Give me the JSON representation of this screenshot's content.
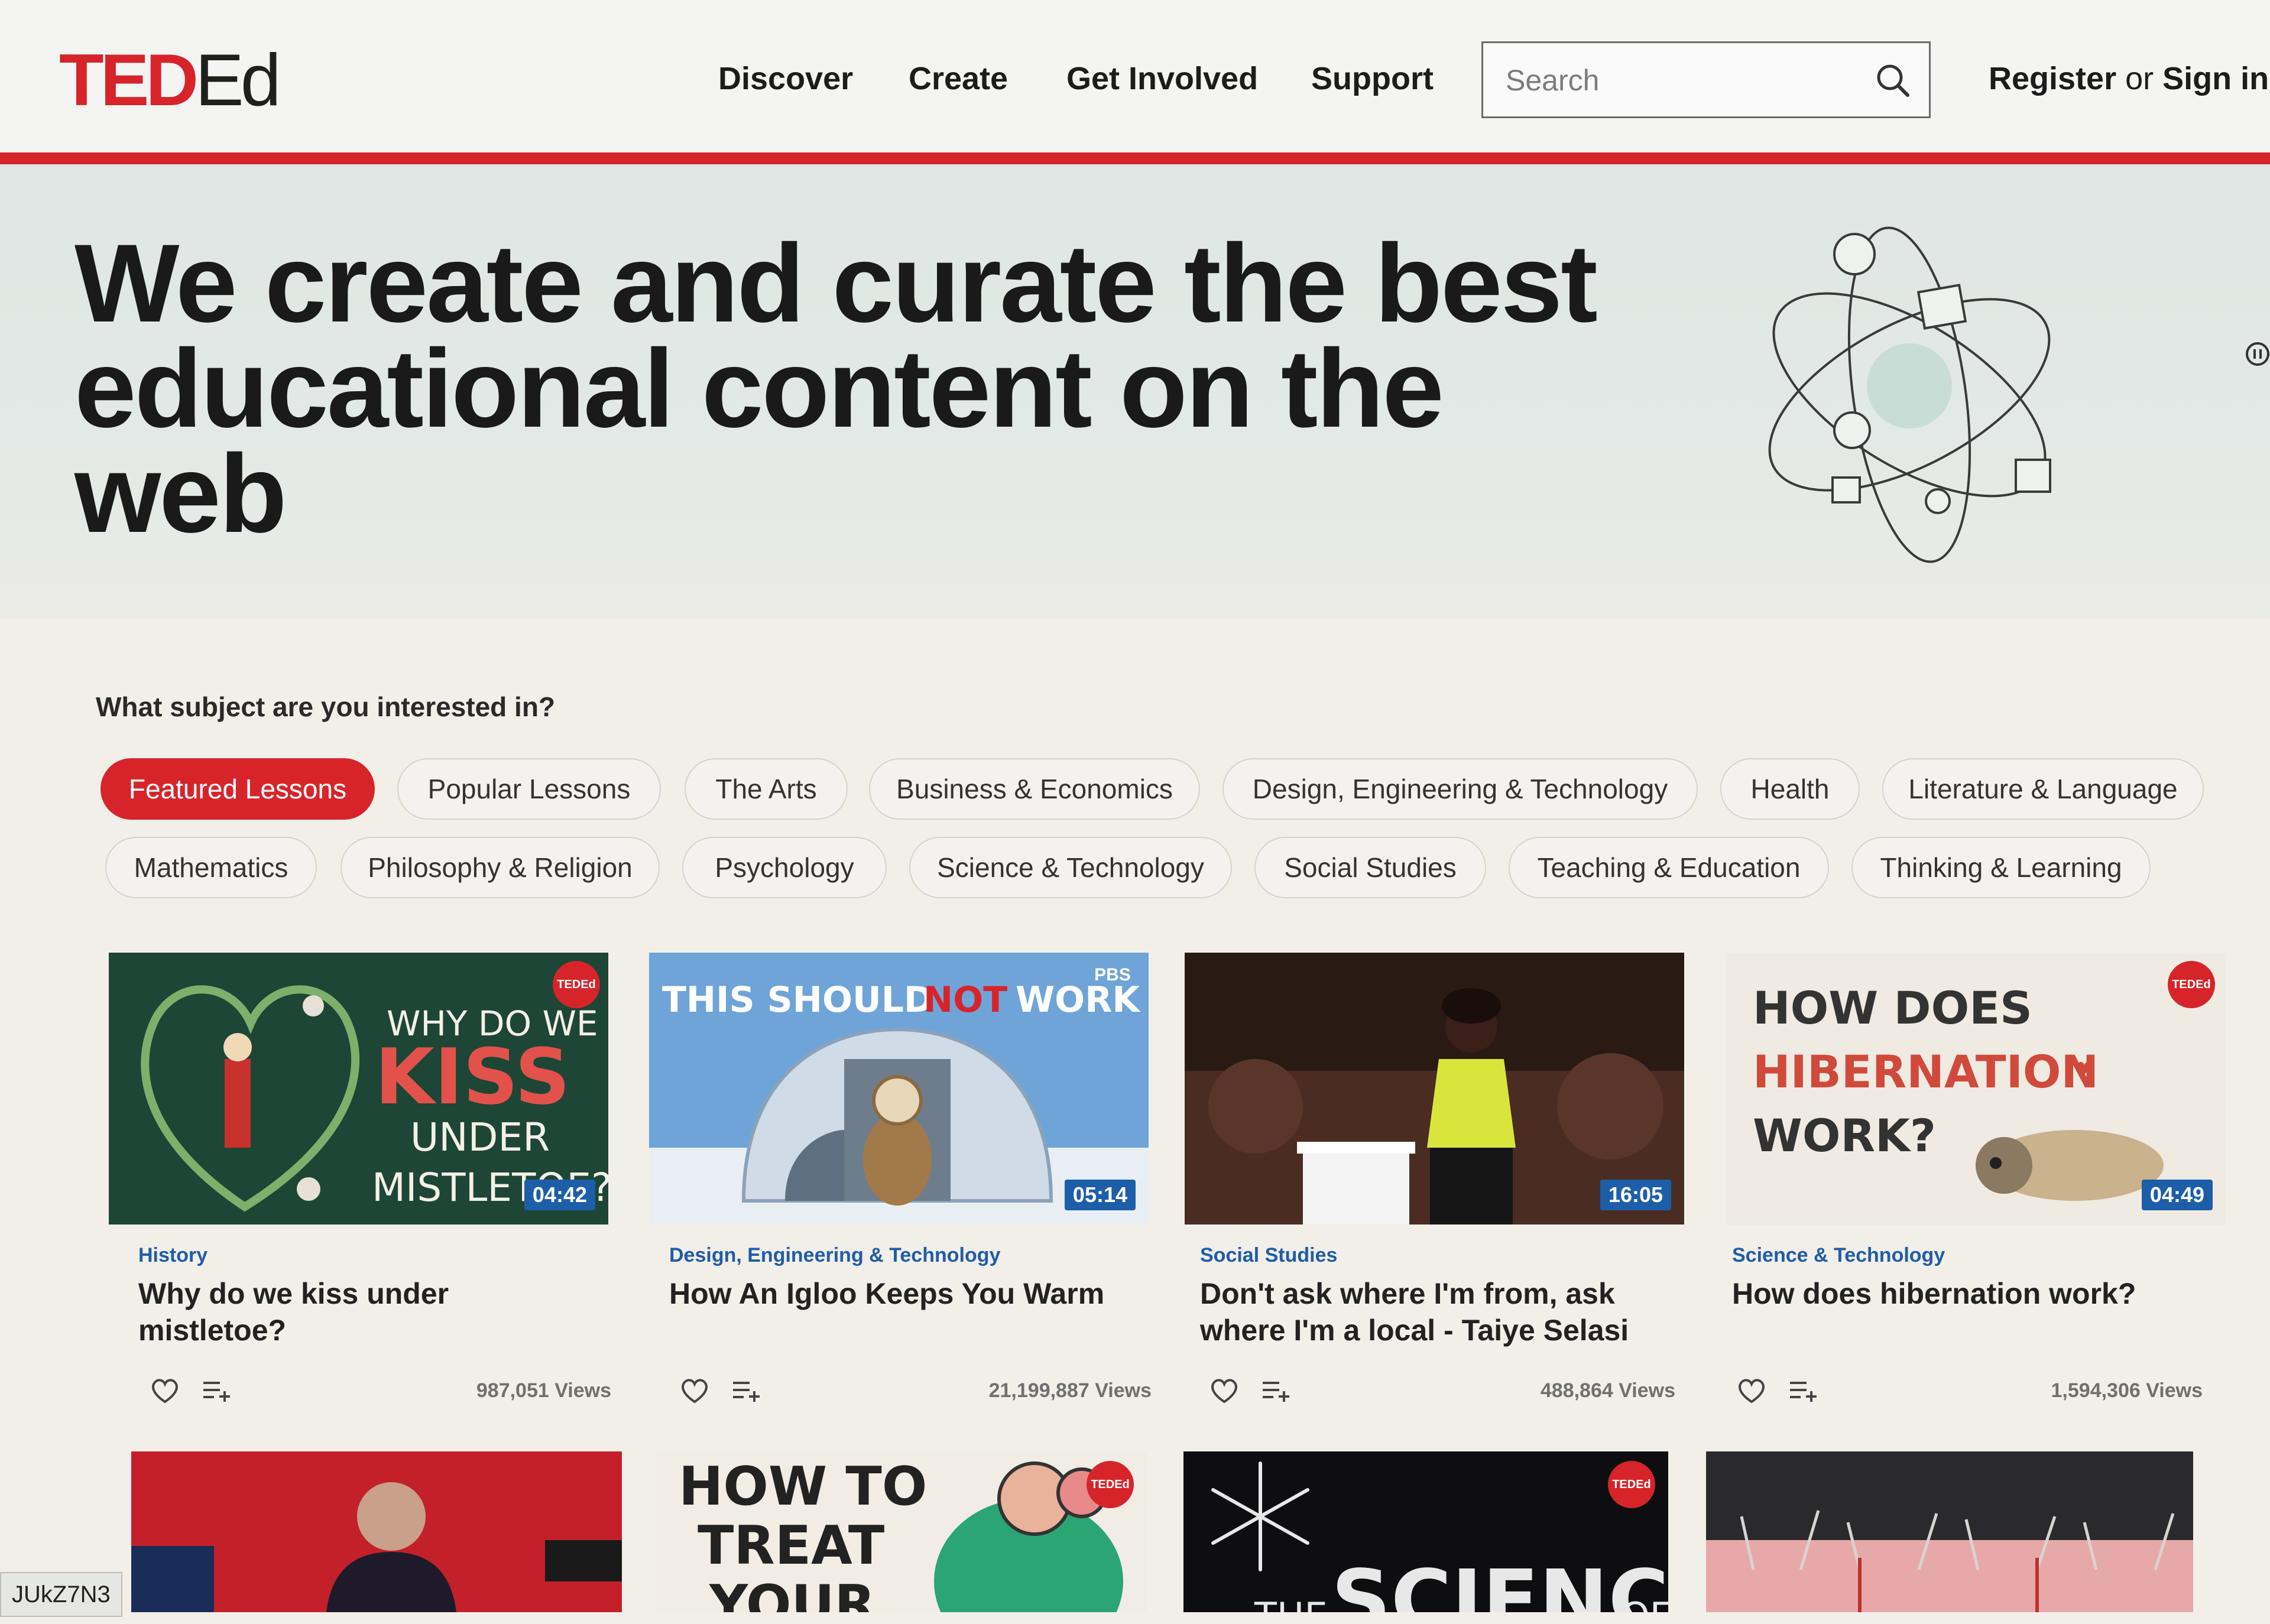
{
  "header": {
    "logo_ted": "TED",
    "logo_ed": "Ed",
    "nav": [
      "Discover",
      "Create",
      "Get Involved",
      "Support"
    ],
    "search_placeholder": "Search",
    "auth_register": "Register",
    "auth_or": "or",
    "auth_signin": "Sign in"
  },
  "hero": {
    "title": "We create and curate the best educational content on the web"
  },
  "subjects": {
    "question": "What subject are you interested in?",
    "active": "Featured Lessons",
    "row1": [
      "Featured Lessons",
      "Popular Lessons",
      "The Arts",
      "Business & Economics",
      "Design, Engineering & Technology",
      "Health",
      "Literature & Language"
    ],
    "row2": [
      "Mathematics",
      "Philosophy & Religion",
      "Psychology",
      "Science & Technology",
      "Social Studies",
      "Teaching & Education",
      "Thinking & Learning"
    ]
  },
  "lessons": [
    {
      "category": "History",
      "title": "Why do we kiss under mistletoe?",
      "duration": "04:42",
      "views": "987,051 Views",
      "thumb_text": [
        "WHY DO WE",
        "KISS",
        "UNDER",
        "MISTLETOE?"
      ],
      "badge": "TEDEd"
    },
    {
      "category": "Design, Engineering & Technology",
      "title": "How An Igloo Keeps You Warm",
      "duration": "05:14",
      "views": "21,199,887 Views",
      "thumb_text": [
        "THIS SHOULD",
        "NOT",
        "WORK"
      ],
      "badge": "PBS"
    },
    {
      "category": "Social Studies",
      "title": "Don't ask where I'm from, ask where I'm a local - Taiye Selasi",
      "duration": "16:05",
      "views": "488,864 Views"
    },
    {
      "category": "Science & Technology",
      "title": "How does hibernation work?",
      "duration": "04:49",
      "views": "1,594,306 Views",
      "thumb_text": [
        "HOW DOES",
        "HIBERNATION",
        "WORK?"
      ],
      "badge": "TEDEd"
    }
  ],
  "bottom_row": [
    {
      "thumb_text": []
    },
    {
      "thumb_text": [
        "HOW TO",
        "TREAT",
        "YOUR"
      ],
      "badge": "TEDEd"
    },
    {
      "thumb_text": [
        "THE",
        "SCIENCE",
        "OF"
      ],
      "badge": "TEDEd"
    },
    {
      "thumb_text": []
    }
  ],
  "url_fragment": "JUkZ7N3",
  "colors": {
    "brand_red": "#d7242b",
    "category_blue": "#1f5da8",
    "duration_blue": "#1d5ea8"
  }
}
